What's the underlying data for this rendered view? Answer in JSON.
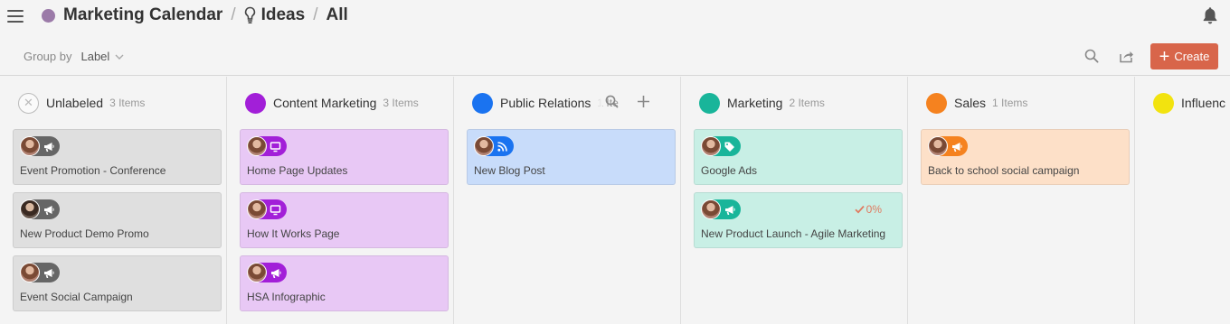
{
  "header": {
    "calendar_name": "Marketing Calendar",
    "separator": "/",
    "section": "Ideas",
    "view": "All",
    "calendar_color": "#9b7aa8"
  },
  "toolbar": {
    "group_by_label": "Group by",
    "group_by_value": "Label",
    "create_label": "Create",
    "create_color": "#d8654a"
  },
  "columns": [
    {
      "title": "Unlabeled",
      "count": "3 Items",
      "color": "#ffffff",
      "card_color": "#dfdfdf",
      "cards": [
        {
          "title": "Event Promotion - Conference",
          "icon": "megaphone-icon",
          "badge_color": "#666666"
        },
        {
          "title": "New Product Demo Promo",
          "icon": "megaphone-icon",
          "badge_color": "#666666"
        },
        {
          "title": "Event Social Campaign",
          "icon": "megaphone-icon",
          "badge_color": "#666666"
        }
      ]
    },
    {
      "title": "Content Marketing",
      "count": "3 Items",
      "color": "#a21fd8",
      "card_color": "#e8c8f5",
      "cards": [
        {
          "title": "Home Page Updates",
          "icon": "monitor-icon",
          "badge_color": "#a21fd8"
        },
        {
          "title": "How It Works Page",
          "icon": "monitor-icon",
          "badge_color": "#a21fd8"
        },
        {
          "title": "HSA Infographic",
          "icon": "megaphone-icon",
          "badge_color": "#a21fd8"
        }
      ]
    },
    {
      "title": "Public Relations",
      "count": "1 Ite",
      "color": "#1a73f0",
      "card_color": "#c8dcfa",
      "cards": [
        {
          "title": "New Blog Post",
          "icon": "rss-icon",
          "badge_color": "#1a73f0"
        }
      ]
    },
    {
      "title": "Marketing",
      "count": "2 Items",
      "color": "#19b59a",
      "card_color": "#c8efe5",
      "cards": [
        {
          "title": "Google Ads",
          "icon": "tag-icon",
          "badge_color": "#19b59a"
        },
        {
          "title": "New Product Launch - Agile Marketing",
          "icon": "megaphone-icon",
          "badge_color": "#19b59a",
          "progress": "0%"
        }
      ]
    },
    {
      "title": "Sales",
      "count": "1 Items",
      "color": "#f5821f",
      "card_color": "#fde0c8",
      "cards": [
        {
          "title": "Back to school social campaign",
          "icon": "megaphone-icon",
          "badge_color": "#f5821f"
        }
      ]
    },
    {
      "title": "Influenc",
      "count": "",
      "color": "#f2e30f",
      "card_color": "#fbf6c0",
      "cards": []
    }
  ]
}
